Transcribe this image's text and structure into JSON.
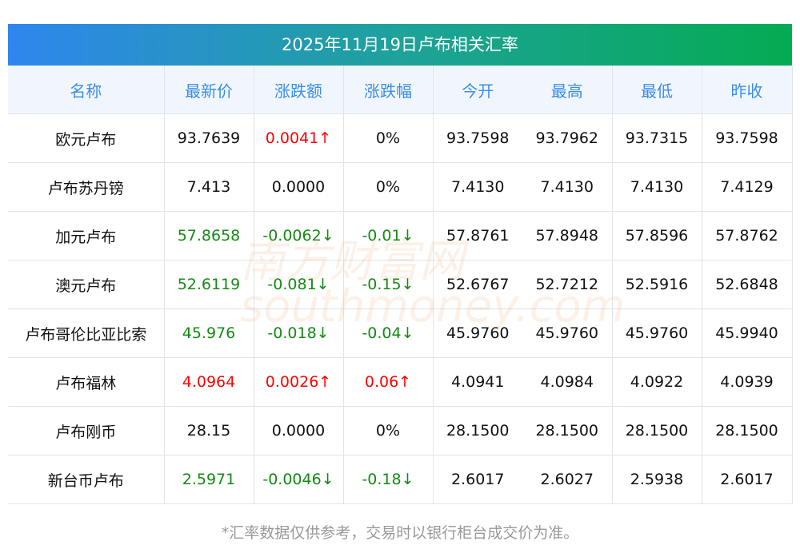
{
  "title": "2025年11月19日卢布相关汇率",
  "columns": [
    "名称",
    "最新价",
    "涨跌额",
    "涨跌幅",
    "今开",
    "最高",
    "最低",
    "昨收"
  ],
  "rows": [
    {
      "name": "欧元卢布",
      "latest": "93.7639",
      "change": "0.0041↑",
      "pct": "0%",
      "open": "93.7598",
      "high": "93.7962",
      "low": "93.7315",
      "prev": "93.7598",
      "lc": "",
      "cc": "up",
      "pc": ""
    },
    {
      "name": "卢布苏丹镑",
      "latest": "7.413",
      "change": "0.0000",
      "pct": "0%",
      "open": "7.4130",
      "high": "7.4130",
      "low": "7.4130",
      "prev": "7.4129",
      "lc": "",
      "cc": "",
      "pc": ""
    },
    {
      "name": "加元卢布",
      "latest": "57.8658",
      "change": "-0.0062↓",
      "pct": "-0.01↓",
      "open": "57.8761",
      "high": "57.8948",
      "low": "57.8596",
      "prev": "57.8762",
      "lc": "down",
      "cc": "down",
      "pc": "down"
    },
    {
      "name": "澳元卢布",
      "latest": "52.6119",
      "change": "-0.081↓",
      "pct": "-0.15↓",
      "open": "52.6767",
      "high": "52.7212",
      "low": "52.5916",
      "prev": "52.6848",
      "lc": "down",
      "cc": "down",
      "pc": "down"
    },
    {
      "name": "卢布哥伦比亚比索",
      "latest": "45.976",
      "change": "-0.018↓",
      "pct": "-0.04↓",
      "open": "45.9760",
      "high": "45.9760",
      "low": "45.9760",
      "prev": "45.9940",
      "lc": "down",
      "cc": "down",
      "pc": "down"
    },
    {
      "name": "卢布福林",
      "latest": "4.0964",
      "change": "0.0026↑",
      "pct": "0.06↑",
      "open": "4.0941",
      "high": "4.0984",
      "low": "4.0922",
      "prev": "4.0939",
      "lc": "up",
      "cc": "up",
      "pc": "up"
    },
    {
      "name": "卢布刚币",
      "latest": "28.15",
      "change": "0.0000",
      "pct": "0%",
      "open": "28.1500",
      "high": "28.1500",
      "low": "28.1500",
      "prev": "28.1500",
      "lc": "",
      "cc": "",
      "pc": ""
    },
    {
      "name": "新台币卢布",
      "latest": "2.5971",
      "change": "-0.0046↓",
      "pct": "-0.18↓",
      "open": "2.6017",
      "high": "2.6027",
      "low": "2.5938",
      "prev": "2.6017",
      "lc": "down",
      "cc": "down",
      "pc": "down"
    }
  ],
  "watermark": "南方财富网 southmoney.com",
  "footnote": "*汇率数据仅供参考，交易时以银行柜台成交价为准。"
}
